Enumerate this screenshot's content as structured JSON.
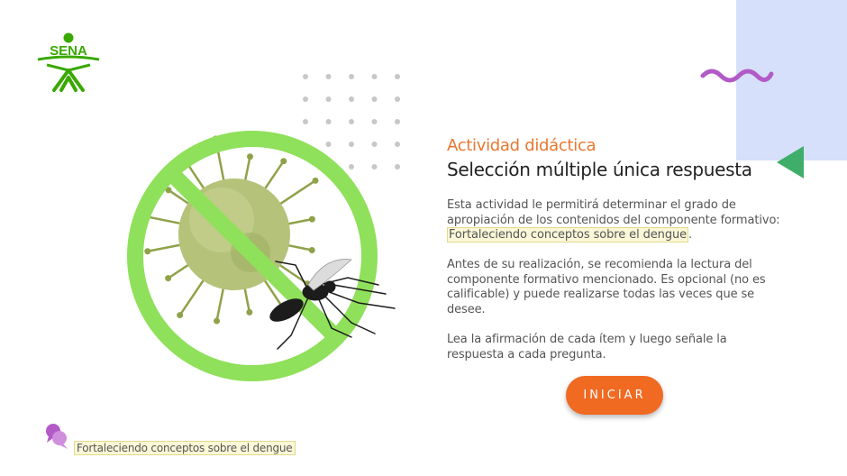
{
  "brand": {
    "logo_text": "SENA",
    "logo_color": "#39a900"
  },
  "hero": {
    "image": "dengue-virus-mosquito-prohibited",
    "ring_color": "#8fe05a"
  },
  "activity": {
    "kicker": "Actividad didáctica",
    "title": "Selección múltiple única respuesta",
    "p1_text": "Esta actividad le permitirá determinar el grado de apropiación de los contenidos del componente formativo: ",
    "p1_link": "Fortaleciendo conceptos sobre el dengue",
    "p1_end": ".",
    "p2": "Antes de su realización, se recomienda la lectura del componente formativo mencionado.  Es opcional (no es calificable) y puede realizarse todas las veces que se desee.",
    "p3": "Lea la afirmación de cada ítem y luego señale la respuesta a cada pregunta."
  },
  "start_button": {
    "label": "INICIAR",
    "color": "#f06a22"
  },
  "footer": {
    "icon": "speech-bubbles-icon",
    "label": "Fortaleciendo conceptos sobre el dengue"
  },
  "decor": {
    "accent_purple": "#b25bc8",
    "accent_green": "#3fae6a",
    "panel_blue": "#d6e0fb"
  }
}
